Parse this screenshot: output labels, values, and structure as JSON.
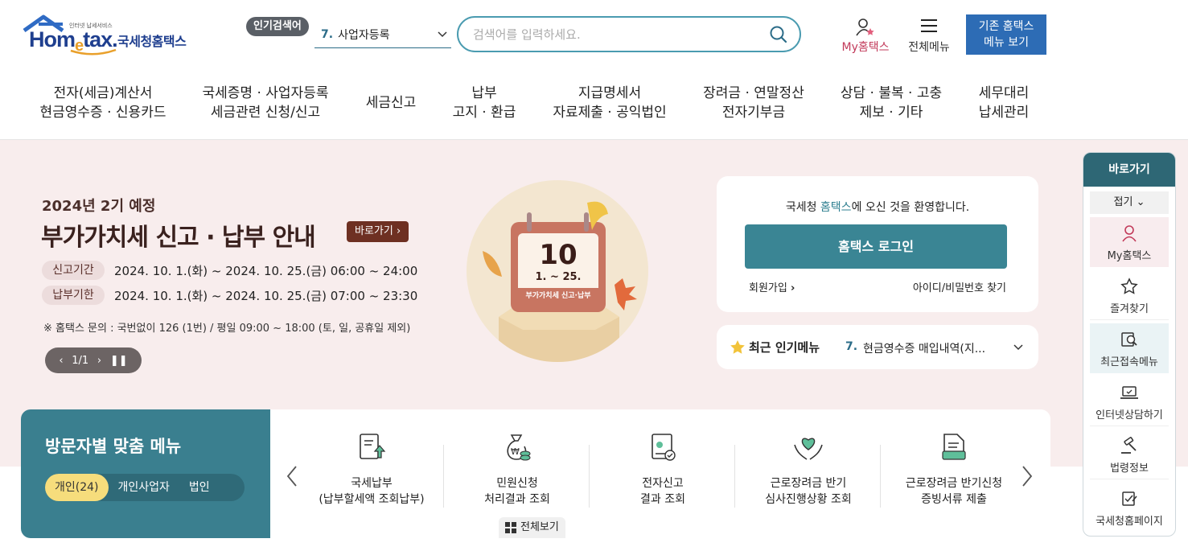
{
  "header": {
    "logo_small": "인터넷 납세서비스",
    "logo_word_a": "Hom",
    "logo_word_e": "e",
    "logo_word_b": "tax.",
    "logo_kor": "국세청홈택스",
    "popular_badge": "인기검색어",
    "popular_num": "7.",
    "popular_value": "사업자등록",
    "search_placeholder": "검색어를 입력하세요.",
    "my_hometax": "My홈택스",
    "all_menu": "전체메뉴",
    "legacy_line1": "기존 홈택스",
    "legacy_line2": "메뉴 보기"
  },
  "gnb": [
    {
      "l1": "전자(세금)계산서",
      "l2": "현금영수증 · 신용카드"
    },
    {
      "l1": "국세증명 · 사업자등록",
      "l2": "세금관련 신청/신고"
    },
    {
      "l1": "세금신고",
      "l2": ""
    },
    {
      "l1": "납부",
      "l2": "고지 · 환급"
    },
    {
      "l1": "지급명세서",
      "l2": "자료제출 · 공익법인"
    },
    {
      "l1": "장려금 · 연말정산",
      "l2": "전자기부금"
    },
    {
      "l1": "상담 · 불복 · 고충",
      "l2": "제보 · 기타"
    },
    {
      "l1": "세무대리",
      "l2": "납세관리"
    }
  ],
  "hero": {
    "sub": "2024년 2기 예정",
    "title": "부가가치세 신고 · 납부 안내",
    "go": "바로가기",
    "filing_label": "신고기간",
    "filing_value": "2024. 10. 1.(화) ~ 2024. 10. 25.(금) 06:00 ~ 24:00",
    "payment_label": "납부기한",
    "payment_value": "2024. 10. 1.(화) ~ 2024. 10. 25.(금) 07:00 ~ 23:30",
    "note": "※ 홈택스 문의 : 국번없이 126 (1번) / 평일 09:00 ~ 18:00 (토, 일, 공휴일 제외)",
    "pager": "1/1",
    "cal_num": "10",
    "cal_range": "1. ~ 25.",
    "cal_caption": "부가가치세 신고·납부"
  },
  "welcome": {
    "msg_a": "국세청 ",
    "msg_hl": "홈택스",
    "msg_b": "에 오신 것을 환영합니다.",
    "login": "홈택스 로그인",
    "join": "회원가입",
    "find": "아이디/비밀번호 찾기"
  },
  "recent": {
    "title": "최근 인기메뉴",
    "num": "7.",
    "value": "현금영수증 매입내역(지..."
  },
  "visitor": {
    "title": "방문자별 맞춤 메뉴",
    "tabs": [
      "개인(24)",
      "개인사업자",
      "법인"
    ],
    "items": [
      {
        "l1": "국세납부",
        "l2": "(납부할세액 조회납부)",
        "icon": "tax-payment-icon"
      },
      {
        "l1": "민원신청",
        "l2": "처리결과 조회",
        "icon": "money-bag-icon"
      },
      {
        "l1": "전자신고",
        "l2": "결과 조회",
        "icon": "e-filing-icon"
      },
      {
        "l1": "근로장려금 반기",
        "l2": "심사진행상황 조회",
        "icon": "heart-hands-icon"
      },
      {
        "l1": "근로장려금 반기신청",
        "l2": "증빙서류 제출",
        "icon": "document-submit-icon"
      }
    ],
    "view_all": "전체보기"
  },
  "quick": {
    "title": "바로가기",
    "fold": "접기",
    "items": [
      "My홈택스",
      "즐겨찾기",
      "최근접속메뉴",
      "인터넷상담하기",
      "법령정보",
      "국세청홈페이지"
    ]
  },
  "colors": {
    "brand_blue": "#1f3f8f",
    "teal": "#3a8594",
    "hero_bg": "#f8eded",
    "my_hometax": "#c23a5a",
    "legacy_btn": "#2d6cb5"
  }
}
